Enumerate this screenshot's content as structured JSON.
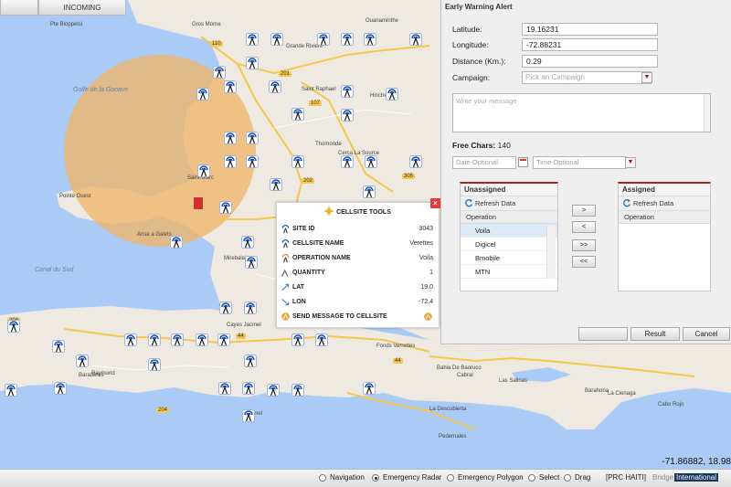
{
  "tabs": [
    {
      "label": ""
    },
    {
      "label": "INCOMING"
    }
  ],
  "map": {
    "coordinate_readout": "-71.86882, 18.98",
    "labels": [
      {
        "text": "Pte Bloppelsi",
        "kind": "town"
      },
      {
        "text": "Gros Morne",
        "kind": "town"
      },
      {
        "text": "Grande Riviere",
        "kind": "town"
      },
      {
        "text": "Saint Raphael",
        "kind": "town"
      },
      {
        "text": "Canal du Sud",
        "kind": "sea"
      },
      {
        "text": "Golfe de la Gonave",
        "kind": "sea"
      },
      {
        "text": "Pointe Ouest",
        "kind": "town"
      },
      {
        "text": "Jacmel",
        "kind": "town"
      },
      {
        "text": "Baradères",
        "kind": "town"
      },
      {
        "text": "Raymond",
        "kind": "town"
      },
      {
        "text": "Pedernales",
        "kind": "town"
      },
      {
        "text": "Barahona",
        "kind": "town"
      },
      {
        "text": "Cabral",
        "kind": "town"
      },
      {
        "text": "La Descubierta",
        "kind": "town"
      },
      {
        "text": "Fonds Verrettes",
        "kind": "town"
      },
      {
        "text": "Bahia De Baoruco",
        "kind": "town"
      },
      {
        "text": "Las Salinas",
        "kind": "town"
      },
      {
        "text": "Ouanaminthe",
        "kind": "town"
      },
      {
        "text": "Mirebalais",
        "kind": "town"
      },
      {
        "text": "Hinche",
        "kind": "town"
      },
      {
        "text": "Cerca La Source",
        "kind": "town"
      },
      {
        "text": "Thomonde",
        "kind": "town"
      },
      {
        "text": "Cayes Jacmel",
        "kind": "town"
      },
      {
        "text": "Saint-Marc",
        "kind": "town"
      },
      {
        "text": "Anse a Galets",
        "kind": "town"
      },
      {
        "text": "Cabo Rojo",
        "kind": "town"
      },
      {
        "text": "La Cienaga",
        "kind": "town"
      }
    ],
    "road_labels": [
      "110",
      "107",
      "201",
      "202",
      "305",
      "208",
      "44",
      "44",
      "204"
    ],
    "tower_count": 52
  },
  "cellsite": {
    "title": "CELLSITE TOOLS",
    "rows": [
      {
        "label": "SITE ID",
        "value": "3043",
        "icon": "tower-icon"
      },
      {
        "label": "CELLSITE NAME",
        "value": "Verettes",
        "icon": "tower-icon"
      },
      {
        "label": "OPERATION NAME",
        "value": "Voila",
        "icon": "operator-icon"
      },
      {
        "label": "QUANTITY",
        "value": "1",
        "icon": "quantity-icon"
      },
      {
        "label": "LAT",
        "value": "19.0",
        "icon": "latitude-icon"
      },
      {
        "label": "LON",
        "value": "-72.4",
        "icon": "longitude-icon"
      },
      {
        "label": "SEND MESSAGE TO CELLSITE",
        "value": "",
        "icon": "rss-icon"
      }
    ]
  },
  "ewa": {
    "title": "Early Warning Alert",
    "latitude_label": "Latitude:",
    "latitude_value": "19.16231",
    "longitude_label": "Longitude:",
    "longitude_value": "-72.88231",
    "distance_label": "Distance (Km.):",
    "distance_value": "0.29",
    "campaign_label": "Campaign:",
    "campaign_placeholder": "Pick an Campaign",
    "message_placeholder": "Write your message",
    "free_chars_label": "Free Chars:",
    "free_chars_value": "140",
    "date_placeholder": "Date Optional",
    "time_placeholder": "Time Optional",
    "unassigned": {
      "title": "Unassigned",
      "refresh": "Refresh Data",
      "column": "Operation",
      "items": [
        "Voila",
        "Digicel",
        "Bmobile",
        "MTN"
      ],
      "selected": "Voila"
    },
    "assigned": {
      "title": "Assigned",
      "refresh": "Refresh Data",
      "column": "Operation",
      "items": []
    },
    "move_buttons": [
      ">",
      "<",
      ">>",
      "<<"
    ],
    "result_button": "Result",
    "cancel_button": "Cancel"
  },
  "status": {
    "modes": [
      {
        "label": "Navigation",
        "selected": false
      },
      {
        "label": "Emergency Radar",
        "selected": true
      },
      {
        "label": "Emergency Polygon",
        "selected": false
      },
      {
        "label": "Select",
        "selected": false
      },
      {
        "label": "Drag",
        "selected": false
      }
    ],
    "region": "[PRC HAITI]",
    "layer_active": "International",
    "layer_inactive": "Bridge"
  },
  "colors": {
    "sea": "#aacbf5",
    "land": "#eeeae1",
    "radar_fill": "#f0b56a",
    "accent_red": "#b22222",
    "road": "#f6c64d"
  }
}
